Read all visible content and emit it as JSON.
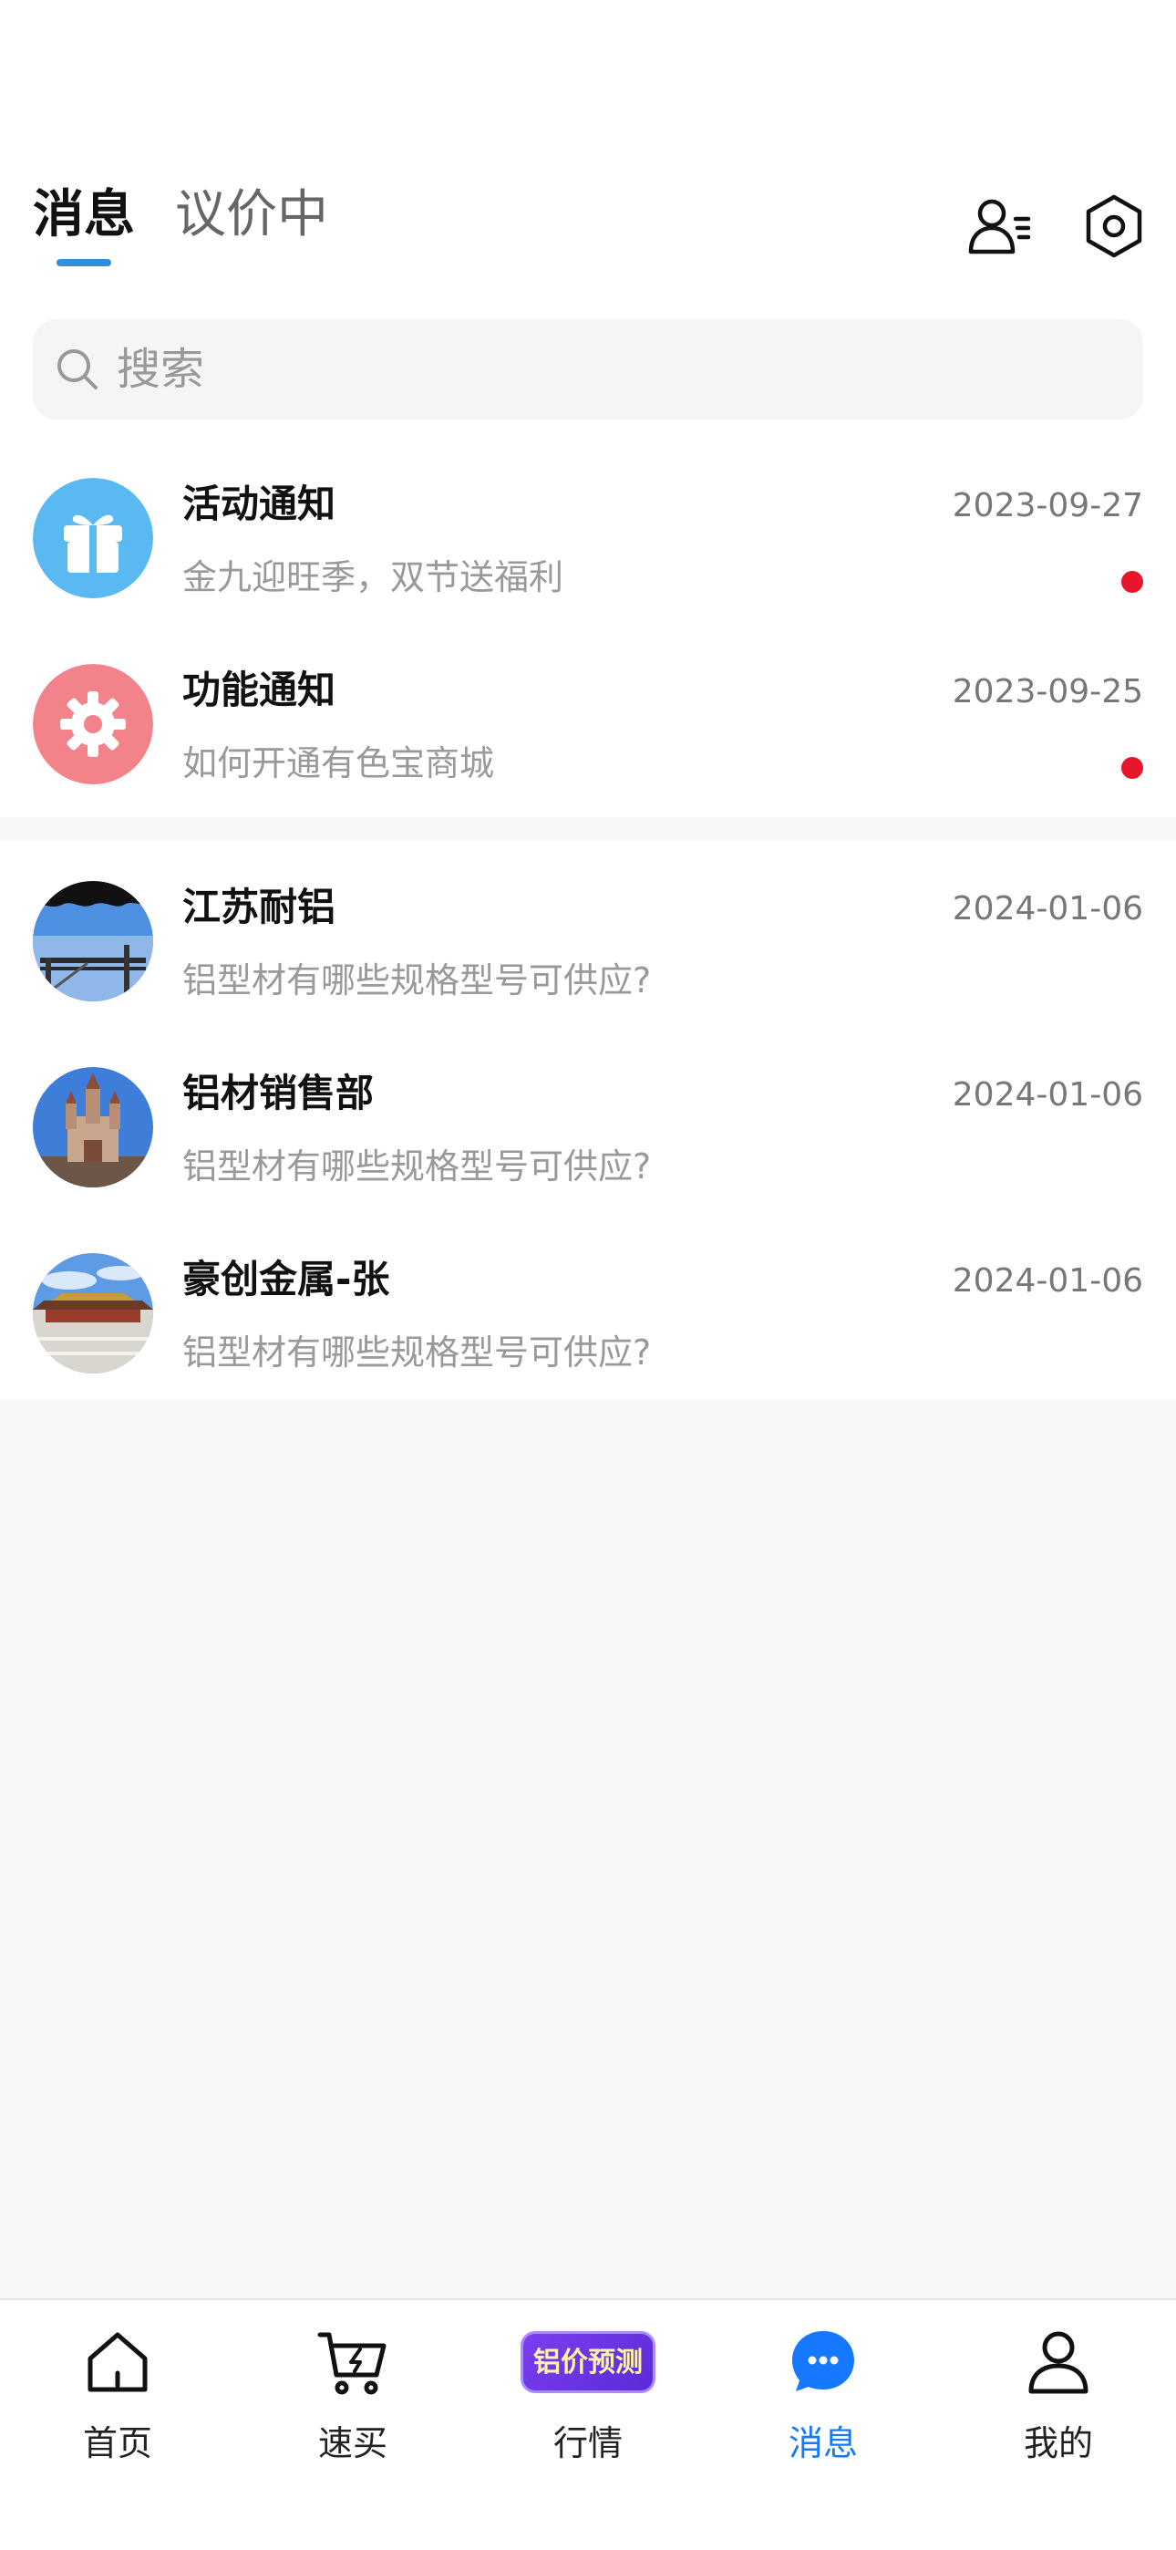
{
  "header": {
    "tabs": [
      "消息",
      "议价中"
    ],
    "active_tab": "消息"
  },
  "search": {
    "placeholder": "搜索"
  },
  "notices": [
    {
      "title": "活动通知",
      "preview": "金九迎旺季，双节送福利",
      "time": "2023-09-27",
      "unread": true,
      "icon": "gift-icon",
      "color": "#5bb9f2"
    },
    {
      "title": "功能通知",
      "preview": "如何开通有色宝商城",
      "time": "2023-09-25",
      "unread": true,
      "icon": "gear-icon",
      "color": "#f3838a"
    }
  ],
  "chats": [
    {
      "name": "江苏耐铝",
      "preview": "铝型材有哪些规格型号可供应?",
      "time": "2024-01-06"
    },
    {
      "name": "铝材销售部",
      "preview": "铝型材有哪些规格型号可供应?",
      "time": "2024-01-06"
    },
    {
      "name": "豪创金属-张",
      "preview": "铝型材有哪些规格型号可供应?",
      "time": "2024-01-06"
    }
  ],
  "tabbar": {
    "items": [
      {
        "label": "首页",
        "icon": "home-icon"
      },
      {
        "label": "速买",
        "icon": "cart-icon"
      },
      {
        "label": "行情",
        "icon": "price-forecast-badge",
        "badge_text": "铝价预测"
      },
      {
        "label": "消息",
        "icon": "chat-bubble-icon",
        "active": true
      },
      {
        "label": "我的",
        "icon": "person-icon"
      }
    ]
  },
  "colors": {
    "accent": "#1677ff",
    "tab_underline": "#2f8fde",
    "unread_dot": "#e8162b",
    "badge_purple": "#6a35e8"
  }
}
